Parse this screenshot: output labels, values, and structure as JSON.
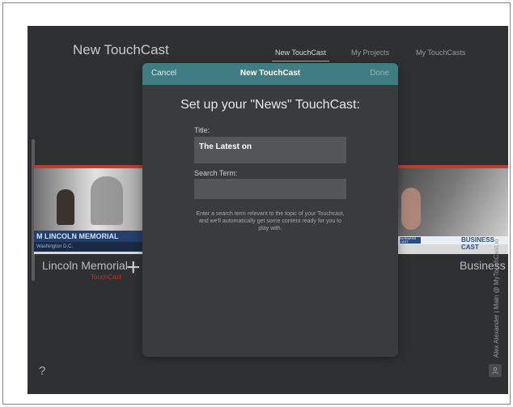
{
  "app": {
    "title": "New TouchCast",
    "help_label": "?"
  },
  "nav": {
    "tabs": [
      {
        "label": "New TouchCast",
        "active": true
      },
      {
        "label": "My Projects",
        "active": false
      },
      {
        "label": "My TouchCasts",
        "active": false
      }
    ]
  },
  "carousel": {
    "left": {
      "name": "Lincoln Memorial",
      "subtitle": "TouchCast",
      "banner": "M LINCOLN MEMORIAL",
      "banner_sub": "Washington D.C."
    },
    "right": {
      "name": "Business Ca",
      "banner": "BUSINESS CAST",
      "badge": "BUSINESS CAST"
    }
  },
  "sidebar_vertical": {
    "user": "Alex Alexander",
    "separator": "|",
    "channel": "Main @ MyTouchCast.io"
  },
  "modal": {
    "cancel": "Cancel",
    "title": "New TouchCast",
    "done": "Done",
    "heading": "Set up your \"News\" TouchCast:",
    "title_label": "Title:",
    "title_value": "The Latest on",
    "search_label": "Search Term:",
    "search_value": "",
    "hint": "Enter a search term relevant to the topic of your Touchcast, and we'll automatically get some content ready for you to play with."
  },
  "colors": {
    "accent_teal": "#3f7d82",
    "subtitle_red": "#b13a32",
    "background": "#2f3031"
  },
  "icons": [
    "plus-icon",
    "help-icon",
    "user-icon"
  ]
}
